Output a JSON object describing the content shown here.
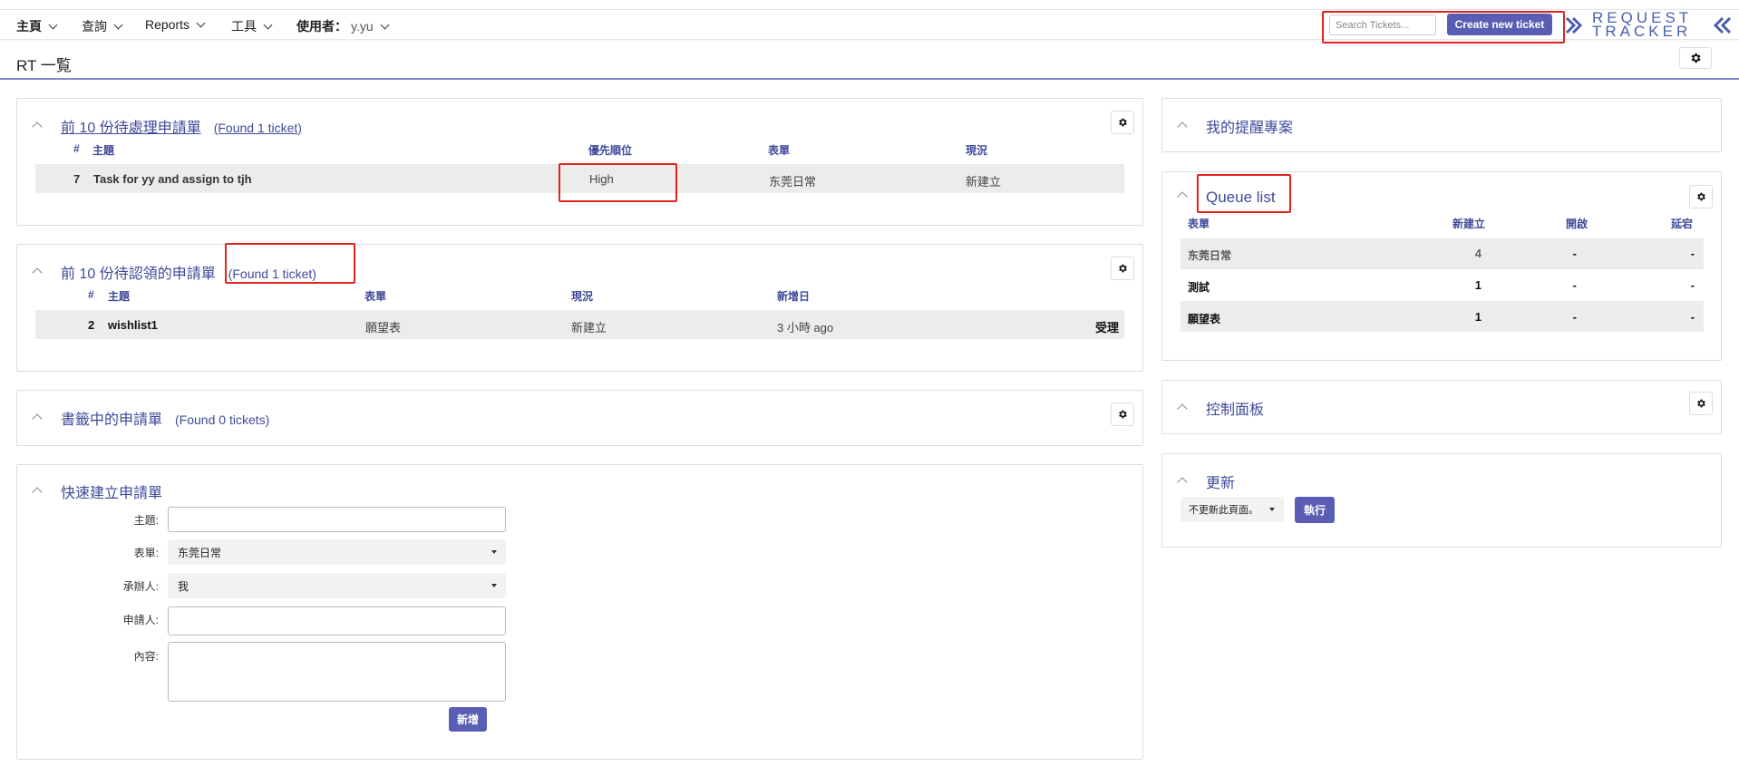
{
  "nav": {
    "home": "主頁",
    "search": "查詢",
    "reports": "Reports",
    "tools": "工具",
    "user_label": "使用者：",
    "user_value": "y.yu"
  },
  "search": {
    "placeholder": "Search Tickets..."
  },
  "create_ticket": "Create new ticket",
  "logo": {
    "line1": "REQUEST",
    "line2": "TRACKER"
  },
  "page": {
    "title": "RT 一覧"
  },
  "top10_pending": {
    "title": "前 10 份待處理申請單",
    "found": "(Found 1 ticket)",
    "columns": [
      "#",
      "主題",
      "優先順位",
      "表單",
      "現況"
    ],
    "rows": [
      {
        "id": "7",
        "subject": "Task for yy and assign to tjh",
        "priority": "High",
        "queue": "东莞日常",
        "status": "新建立"
      }
    ]
  },
  "top10_unowned": {
    "title": "前 10 份待認領的申請單",
    "found": "(Found 1 ticket)",
    "columns": [
      "#",
      "主題",
      "表單",
      "現況",
      "新增日"
    ],
    "rows": [
      {
        "id": "2",
        "subject": "wishlist1",
        "queue": "願望表",
        "status": "新建立",
        "created": "3 小時 ago",
        "action": "受理"
      }
    ]
  },
  "bookmarked": {
    "title": "書籤中的申請單",
    "found": "(Found 0 tickets)"
  },
  "quick_create": {
    "title": "快速建立申請單",
    "labels": {
      "subject": "主題:",
      "queue": "表單:",
      "owner": "承辦人:",
      "requestor": "申請人:",
      "content": "內容:"
    },
    "values": {
      "subject": "",
      "queue": "东莞日常",
      "owner": "我",
      "requestor": "",
      "content": ""
    },
    "submit": "新增"
  },
  "reminders": {
    "title": "我的提醒專案"
  },
  "queue_list": {
    "title": "Queue list",
    "columns": [
      "表單",
      "新建立",
      "開啟",
      "延宕"
    ],
    "rows": [
      {
        "queue": "东莞日常",
        "new": "4",
        "open": "-",
        "stalled": "-"
      },
      {
        "queue": "測試",
        "new": "1",
        "open": "-",
        "stalled": "-"
      },
      {
        "queue": "願望表",
        "new": "1",
        "open": "-",
        "stalled": "-"
      }
    ]
  },
  "dashboards": {
    "title": "控制面板"
  },
  "refresh": {
    "title": "更新",
    "option": "不更新此頁面。",
    "go": "執行"
  },
  "colors": {
    "accent": "#5a5db4",
    "link": "#3f4a9a",
    "highlight": "#e0241e"
  }
}
